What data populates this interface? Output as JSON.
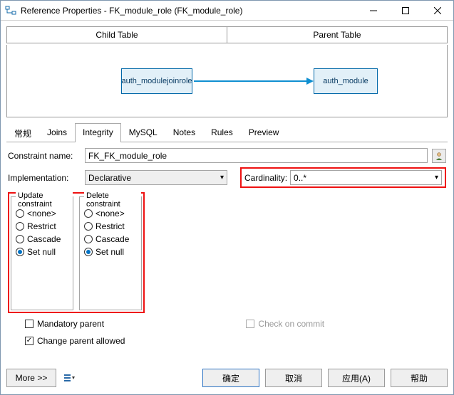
{
  "window": {
    "title": "Reference Properties - FK_module_role (FK_module_role)"
  },
  "header": {
    "child_table": "Child Table",
    "parent_table": "Parent Table"
  },
  "diagram": {
    "child_entity": "auth_modulejoinrole",
    "parent_entity": "auth_module"
  },
  "tabs": {
    "t0": "常规",
    "t1": "Joins",
    "t2": "Integrity",
    "t3": "MySQL",
    "t4": "Notes",
    "t5": "Rules",
    "t6": "Preview"
  },
  "form": {
    "constraint_name_label": "Constraint name:",
    "constraint_name_value": "FK_FK_module_role",
    "implementation_label": "Implementation:",
    "implementation_value": "Declarative",
    "cardinality_label": "Cardinality:",
    "cardinality_value": "0..*"
  },
  "update_constraint": {
    "legend": "Update constraint",
    "o0": "<none>",
    "o1": "Restrict",
    "o2": "Cascade",
    "o3": "Set null",
    "selected": "Set null"
  },
  "delete_constraint": {
    "legend": "Delete constraint",
    "o0": "<none>",
    "o1": "Restrict",
    "o2": "Cascade",
    "o3": "Set null",
    "selected": "Set null"
  },
  "checks": {
    "mandatory_parent": "Mandatory parent",
    "check_on_commit": "Check on commit",
    "change_parent_allowed": "Change parent allowed"
  },
  "buttons": {
    "more": "More >>",
    "ok": "确定",
    "cancel": "取消",
    "apply": "应用(A)",
    "help": "帮助"
  }
}
